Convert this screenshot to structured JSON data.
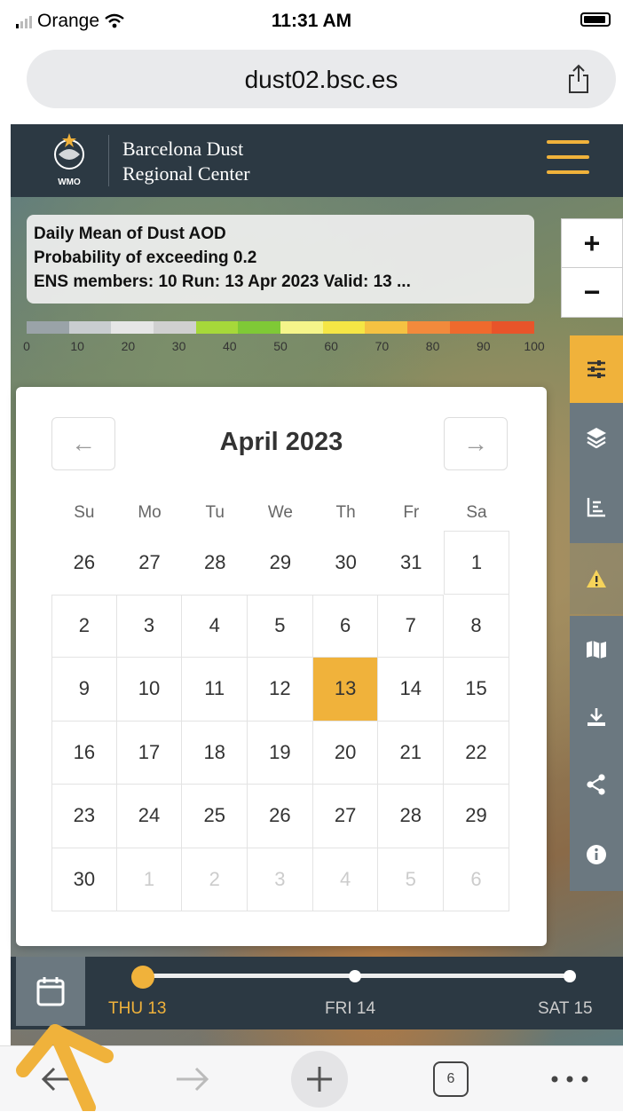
{
  "status_bar": {
    "carrier": "Orange",
    "time": "11:31 AM"
  },
  "browser": {
    "url": "dust02.bsc.es",
    "tab_count": "6"
  },
  "header": {
    "org_line1": "Barcelona Dust",
    "org_line2": "Regional Center",
    "logo_text": "WMO"
  },
  "map_info": {
    "line1": "Daily Mean of Dust AOD",
    "line2": "Probability of exceeding 0.2",
    "line3": "ENS members: 10 Run: 13 Apr 2023 Valid: 13 ..."
  },
  "legend": {
    "ticks": [
      "0",
      "10",
      "20",
      "30",
      "40",
      "50",
      "60",
      "70",
      "80",
      "90",
      "100"
    ],
    "colors": [
      "#9aa3a8",
      "#c9cdd0",
      "#e6e6e6",
      "#d0d0d0",
      "#a6d83a",
      "#7fc936",
      "#f5f58a",
      "#f5e645",
      "#f5c242",
      "#f28a3c",
      "#ef6a2d",
      "#e8542a"
    ]
  },
  "zoom": {
    "in": "+",
    "out": "−"
  },
  "calendar": {
    "month_title": "April 2023",
    "prev": "←",
    "next": "→",
    "weekdays": [
      "Su",
      "Mo",
      "Tu",
      "We",
      "Th",
      "Fr",
      "Sa"
    ],
    "weeks": [
      [
        "26",
        "27",
        "28",
        "29",
        "30",
        "31",
        "1"
      ],
      [
        "2",
        "3",
        "4",
        "5",
        "6",
        "7",
        "8"
      ],
      [
        "9",
        "10",
        "11",
        "12",
        "13",
        "14",
        "15"
      ],
      [
        "16",
        "17",
        "18",
        "19",
        "20",
        "21",
        "22"
      ],
      [
        "23",
        "24",
        "25",
        "26",
        "27",
        "28",
        "29"
      ],
      [
        "30",
        "1",
        "2",
        "3",
        "4",
        "5",
        "6"
      ]
    ],
    "selected": "13"
  },
  "timeline": {
    "labels": [
      "THU 13",
      "FRI 14",
      "SAT 15"
    ],
    "active": 0
  },
  "colors": {
    "accent": "#f0b23b",
    "header_bg": "#2c3943",
    "toolbar_bg": "#6b7880"
  }
}
